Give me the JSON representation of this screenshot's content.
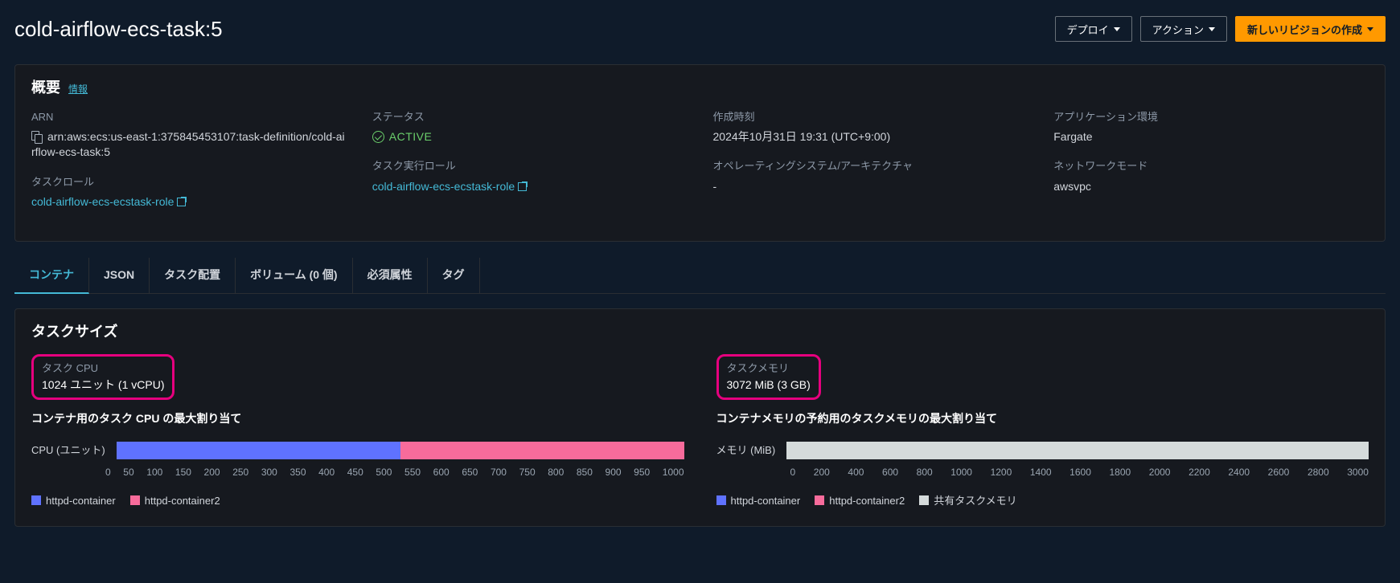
{
  "header": {
    "title": "cold-airflow-ecs-task:5",
    "deploy_label": "デプロイ",
    "actions_label": "アクション",
    "create_revision_label": "新しいリビジョンの作成"
  },
  "overview": {
    "title": "概要",
    "info_label": "情報",
    "arn_label": "ARN",
    "arn_value": "arn:aws:ecs:us-east-1:375845453107:task-definition/cold-airflow-ecs-task:5",
    "status_label": "ステータス",
    "status_value": "ACTIVE",
    "created_label": "作成時刻",
    "created_value": "2024年10月31日 19:31 (UTC+9:00)",
    "appenv_label": "アプリケーション環境",
    "appenv_value": "Fargate",
    "taskrole_label": "タスクロール",
    "taskrole_value": "cold-airflow-ecs-ecstask-role",
    "execrole_label": "タスク実行ロール",
    "execrole_value": "cold-airflow-ecs-ecstask-role",
    "osarch_label": "オペレーティングシステム/アーキテクチャ",
    "osarch_value": "-",
    "network_label": "ネットワークモード",
    "network_value": "awsvpc"
  },
  "tabs": {
    "container": "コンテナ",
    "json": "JSON",
    "placement": "タスク配置",
    "volumes": "ボリューム (0 個)",
    "required": "必須属性",
    "tags": "タグ"
  },
  "tasksize": {
    "title": "タスクサイズ",
    "cpu_label": "タスク CPU",
    "cpu_value": "1024 ユニット (1 vCPU)",
    "cpu_alloc_label": "コンテナ用のタスク CPU の最大割り当て",
    "cpu_axis_label": "CPU (ユニット)",
    "mem_label": "タスクメモリ",
    "mem_value": "3072 MiB (3 GB)",
    "mem_alloc_label": "コンテナメモリの予約用のタスクメモリの最大割り当て",
    "mem_axis_label": "メモリ (MiB)",
    "legend_httpd": "httpd-container",
    "legend_httpd2": "httpd-container2",
    "legend_shared": "共有タスクメモリ"
  },
  "chart_data": [
    {
      "type": "bar",
      "title": "CPU (ユニット)",
      "xlabel": "",
      "ylabel": "",
      "categories": [
        "CPU"
      ],
      "series": [
        {
          "name": "httpd-container",
          "values": [
            512
          ]
        },
        {
          "name": "httpd-container2",
          "values": [
            512
          ]
        }
      ],
      "xlim": [
        0,
        1000
      ],
      "ticks": [
        0,
        50,
        100,
        150,
        200,
        250,
        300,
        350,
        400,
        450,
        500,
        550,
        600,
        650,
        700,
        750,
        800,
        850,
        900,
        950,
        1000
      ]
    },
    {
      "type": "bar",
      "title": "メモリ (MiB)",
      "xlabel": "",
      "ylabel": "",
      "categories": [
        "Memory"
      ],
      "series": [
        {
          "name": "httpd-container",
          "values": [
            0
          ]
        },
        {
          "name": "httpd-container2",
          "values": [
            0
          ]
        },
        {
          "name": "共有タスクメモリ",
          "values": [
            3072
          ]
        }
      ],
      "xlim": [
        0,
        3000
      ],
      "ticks": [
        0,
        200,
        400,
        600,
        800,
        1000,
        1200,
        1400,
        1600,
        1800,
        2000,
        2200,
        2400,
        2600,
        2800,
        3000
      ]
    }
  ]
}
